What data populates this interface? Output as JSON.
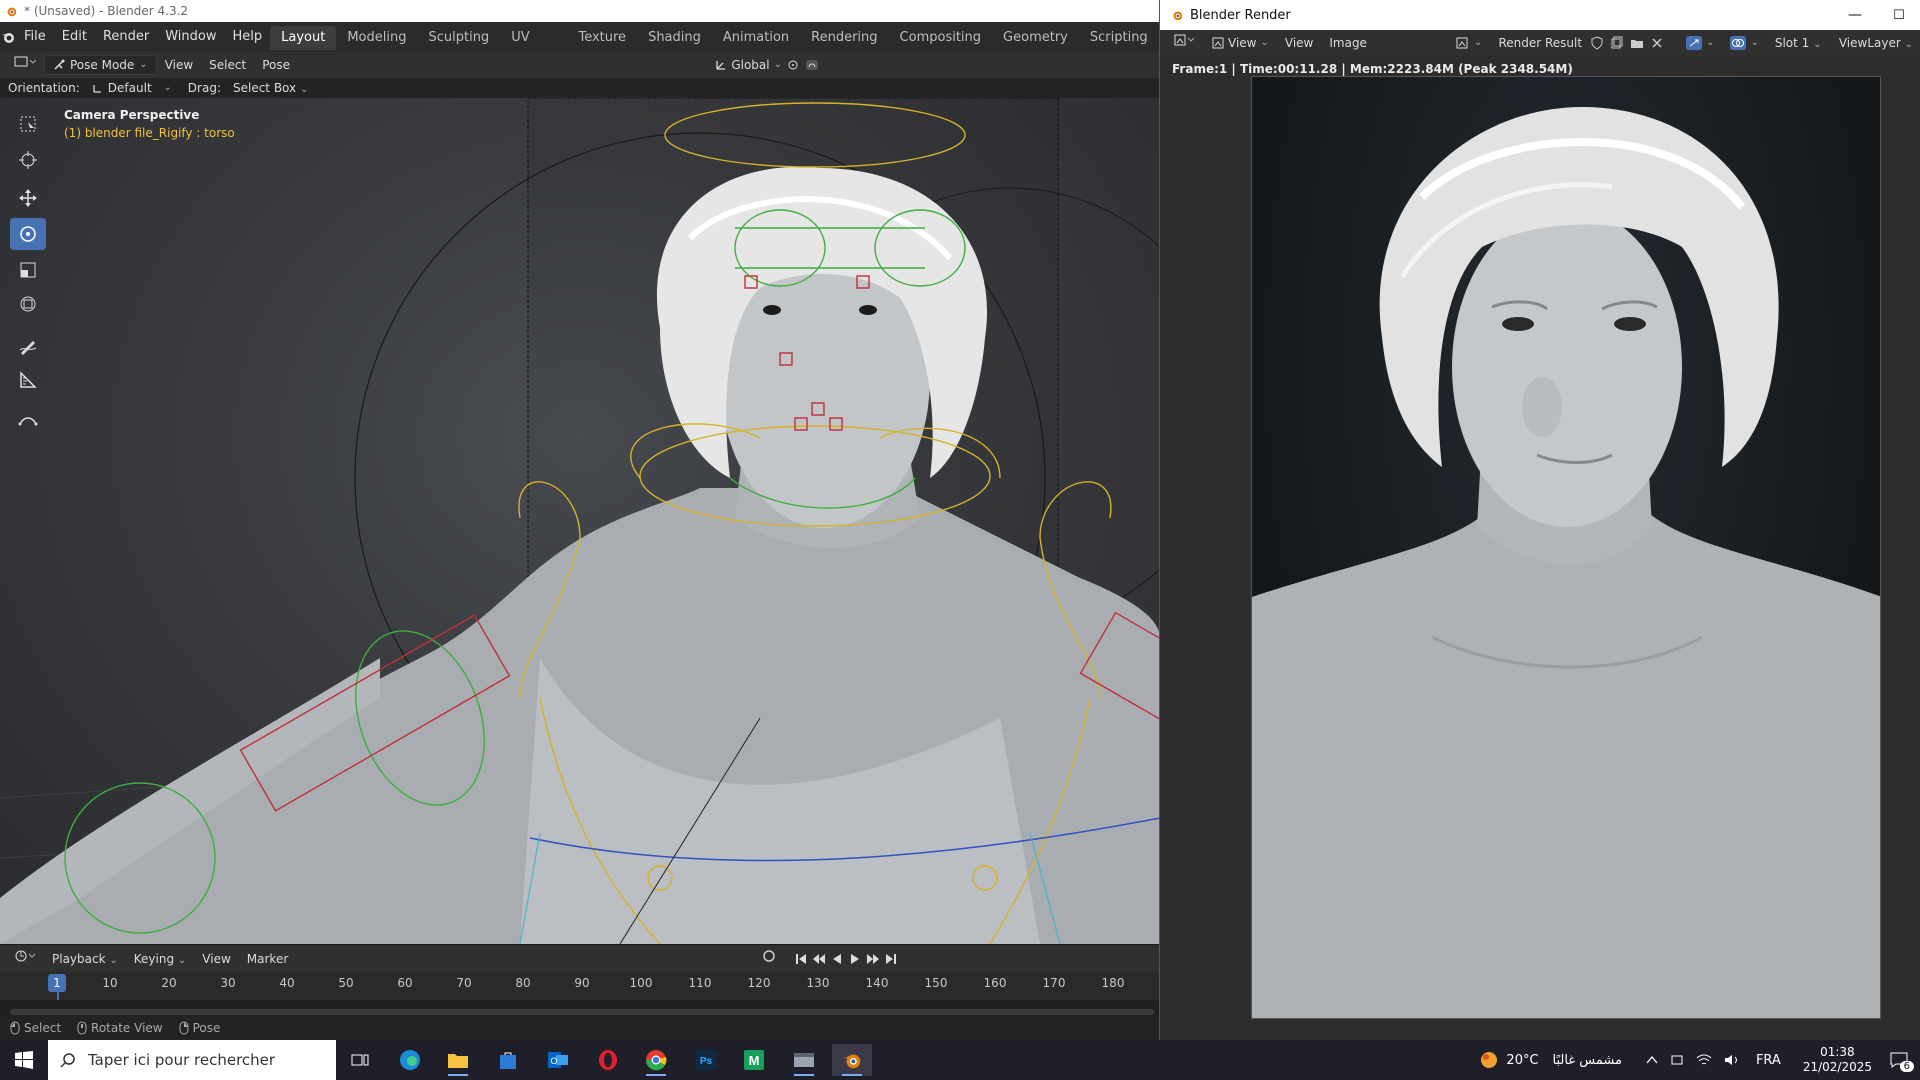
{
  "main_window": {
    "title": "* (Unsaved) - Blender 4.3.2",
    "menus": [
      "File",
      "Edit",
      "Render",
      "Window",
      "Help"
    ],
    "workspaces": [
      "Layout",
      "Modeling",
      "Sculpting",
      "UV Editing",
      "Texture Paint",
      "Shading",
      "Animation",
      "Rendering",
      "Compositing",
      "Geometry Nodes",
      "Scripting"
    ],
    "active_workspace": "Layout",
    "header": {
      "mode": "Pose Mode",
      "view": "View",
      "select": "Select",
      "pose": "Pose",
      "transform_orientation": "Global"
    },
    "tool_settings": {
      "orientation_label": "Orientation:",
      "orientation_value": "Default",
      "drag_label": "Drag:",
      "drag_value": "Select Box"
    },
    "viewport": {
      "camera_title": "Camera Perspective",
      "object_info": "(1) blender file_Rigify : torso"
    },
    "timeline": {
      "playback": "Playback",
      "keying": "Keying",
      "view": "View",
      "marker": "Marker",
      "current_frame": "1",
      "ticks": [
        "10",
        "20",
        "30",
        "40",
        "50",
        "60",
        "70",
        "80",
        "90",
        "100",
        "110",
        "120",
        "130",
        "140",
        "150",
        "160",
        "170",
        "180"
      ]
    },
    "status": {
      "select": "Select",
      "rotate": "Rotate View",
      "pose": "Pose"
    }
  },
  "render_window": {
    "title": "Blender Render",
    "view": "View",
    "view2": "View",
    "image": "Image",
    "result": "Render Result",
    "slot": "Slot 1",
    "view_layer": "ViewLayer",
    "info": "Frame:1 | Time:00:11.28 | Mem:2223.84M (Peak 2348.54M)"
  },
  "taskbar": {
    "search_placeholder": "Taper ici pour rechercher",
    "weather_temp": "20°C",
    "weather_text": "مشمس غالبًا",
    "language": "FRA",
    "time": "01:38",
    "date": "21/02/2025",
    "notifications": "6"
  },
  "colors": {
    "accent": "#4772b3",
    "rig_yellow": "#d6b22a",
    "rig_green": "#3fae3f",
    "rig_red": "#c0303a",
    "rig_blue": "#3050c0"
  }
}
